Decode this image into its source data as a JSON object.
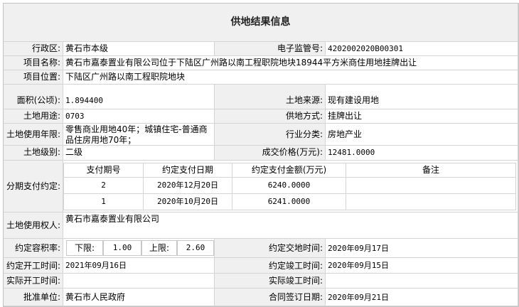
{
  "title": "供地结果信息",
  "labels": {
    "district": "行政区:",
    "supervision_no": "电子监管号:",
    "project_name": "项目名称:",
    "project_location": "项目位置:",
    "area": "面积(公顷):",
    "land_source": "土地来源:",
    "land_use": "土地用途:",
    "supply_method": "供地方式:",
    "use_term": "土地使用年限:",
    "industry": "行业分类:",
    "land_grade": "土地级别:",
    "price": "成交价格(万元):",
    "installments": "分期支付约定:",
    "land_user": "土地使用权人:",
    "plot_ratio": "约定容积率:",
    "agreed_delivery": "约定交地时间:",
    "agreed_start": "约定开工时间:",
    "agreed_completion": "约定竣工时间:",
    "actual_start": "实际开工时间:",
    "actual_completion": "实际竣工时间:",
    "approver": "批准单位:",
    "contract_date": "合同签订日期:"
  },
  "values": {
    "district": "黄石市本级",
    "supervision_no": "4202002020B00301",
    "project_name": "黄石市嘉泰置业有限公司位于下陆区广州路以南工程职院地块18944平方米商住用地挂牌出让",
    "project_location": "下陆区广州路以南工程职院地块",
    "area": "1.894400",
    "land_source": "现有建设用地",
    "land_use": "0703",
    "supply_method": "挂牌出让",
    "use_term": "零售商业用地40年；城镇住宅-普通商品住房用地70年；",
    "industry": "房地产业",
    "land_grade": "二级",
    "price": "12481.0000",
    "land_user": "黄石市嘉泰置业有限公司",
    "agreed_delivery": "2020年09月17日",
    "agreed_start": "2021年09月16日",
    "agreed_completion": "2020年09月15日",
    "actual_start": "",
    "actual_completion": "",
    "approver": "黄石市人民政府",
    "contract_date": "2020年09月21日"
  },
  "plot_ratio": {
    "lower_label": "下限:",
    "lower_value": "1.00",
    "upper_label": "上限:",
    "upper_value": "2.60"
  },
  "installment_table": {
    "headers": [
      "支付期号",
      "约定支付日期",
      "约定支付金额(万元)",
      "备注"
    ],
    "rows": [
      [
        "2",
        "2020年12月20日",
        "6240.0000",
        ""
      ],
      [
        "1",
        "2020年10月20日",
        "6241.0000",
        ""
      ]
    ]
  }
}
